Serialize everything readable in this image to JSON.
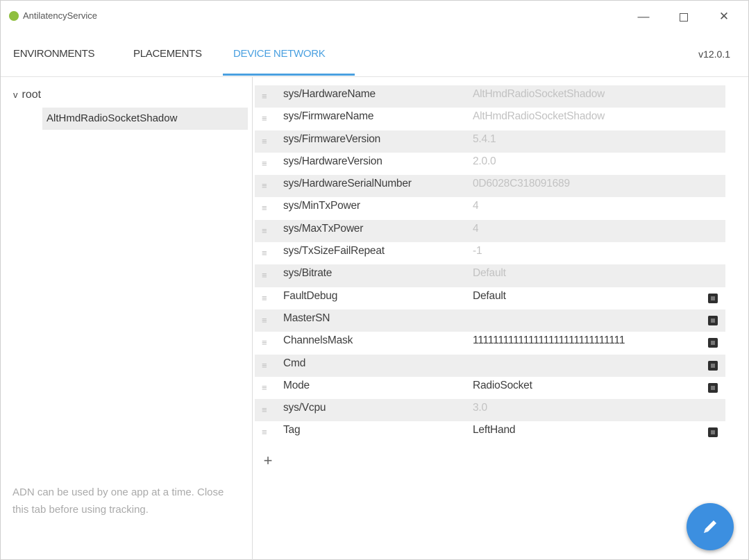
{
  "window": {
    "title": "AntilatencyService"
  },
  "tabs": [
    {
      "label": "ENVIRONMENTS"
    },
    {
      "label": "PLACEMENTS"
    },
    {
      "label": "DEVICE NETWORK"
    }
  ],
  "version": "v12.0.1",
  "tree": {
    "root_label": "root",
    "child_label": "AltHmdRadioSocketShadow"
  },
  "note": "ADN can be used by one app at a time. Close this tab before using tracking.",
  "properties": [
    {
      "key": "sys/HardwareName",
      "value": "AltHmdRadioSocketShadow",
      "editable": false
    },
    {
      "key": "sys/FirmwareName",
      "value": "AltHmdRadioSocketShadow",
      "editable": false
    },
    {
      "key": "sys/FirmwareVersion",
      "value": "5.4.1",
      "editable": false
    },
    {
      "key": "sys/HardwareVersion",
      "value": "2.0.0",
      "editable": false
    },
    {
      "key": "sys/HardwareSerialNumber",
      "value": "0D6028C318091689",
      "editable": false
    },
    {
      "key": "sys/MinTxPower",
      "value": "4",
      "editable": false
    },
    {
      "key": "sys/MaxTxPower",
      "value": "4",
      "editable": false
    },
    {
      "key": "sys/TxSizeFailRepeat",
      "value": "-1",
      "editable": false
    },
    {
      "key": "sys/Bitrate",
      "value": "Default",
      "editable": false
    },
    {
      "key": "FaultDebug",
      "value": "Default",
      "editable": true
    },
    {
      "key": "MasterSN",
      "value": "",
      "editable": true
    },
    {
      "key": "ChannelsMask",
      "value": "111111111111111111111111111111",
      "editable": true
    },
    {
      "key": "Cmd",
      "value": "",
      "editable": true
    },
    {
      "key": "Mode",
      "value": "RadioSocket",
      "editable": true
    },
    {
      "key": "sys/Vcpu",
      "value": "3.0",
      "editable": false
    },
    {
      "key": "Tag",
      "value": "LeftHand",
      "editable": true
    }
  ],
  "colors": {
    "accent": "#4aa0e0",
    "fab": "#3c8fe0"
  },
  "icons": {
    "add": "plus-icon",
    "fab": "pencil-icon",
    "row_handle": "drag-handle-icon",
    "row_delete": "delete-icon"
  }
}
